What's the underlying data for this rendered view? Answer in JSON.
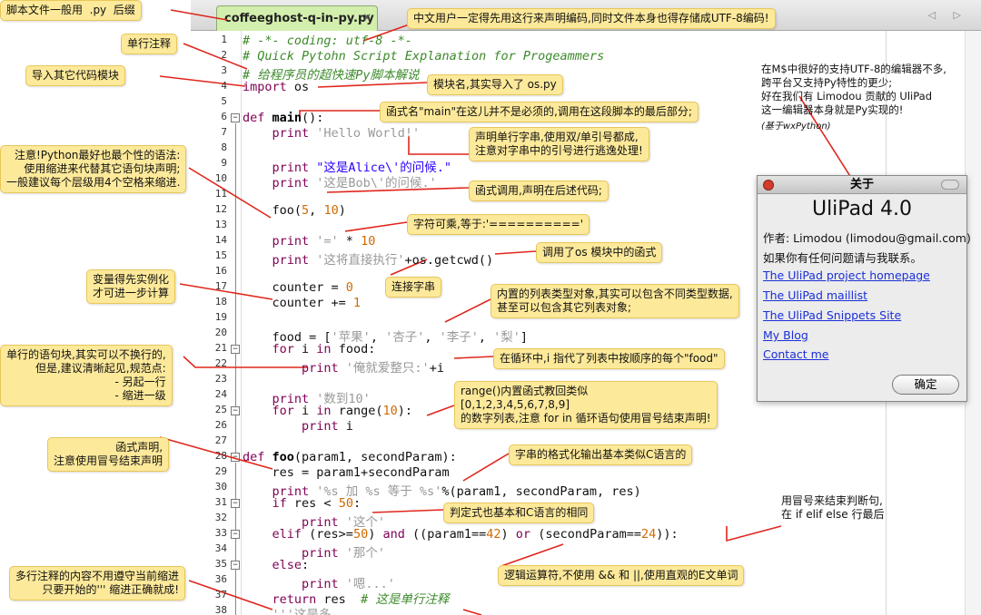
{
  "tab": {
    "filename": "coffeeghost-q-in-py.py",
    "close": "×",
    "nav": "◁ ▷"
  },
  "code_lines": [
    {
      "n": "1",
      "segs": [
        {
          "t": "# -*- coding: utf-8 -*-",
          "c": "cm"
        }
      ]
    },
    {
      "n": "2",
      "segs": [
        {
          "t": "# Quick Pytohn Script Explanation for Progeammers",
          "c": "cm"
        }
      ]
    },
    {
      "n": "3",
      "segs": [
        {
          "t": "# 给程序员的超快速Py脚本解说",
          "c": "cm"
        }
      ]
    },
    {
      "n": "4",
      "segs": [
        {
          "t": "import",
          "c": "kw"
        },
        {
          "t": " os",
          "c": ""
        }
      ]
    },
    {
      "n": "5",
      "segs": []
    },
    {
      "n": "6",
      "segs": [
        {
          "t": "def",
          "c": "kw"
        },
        {
          "t": " ",
          "c": ""
        },
        {
          "t": "main",
          "c": "fn"
        },
        {
          "t": "():",
          "c": ""
        }
      ]
    },
    {
      "n": "7",
      "segs": [
        {
          "t": "    print",
          "c": "kw"
        },
        {
          "t": " 'Hello World!'",
          "c": "str"
        }
      ]
    },
    {
      "n": "8",
      "segs": []
    },
    {
      "n": "9",
      "segs": [
        {
          "t": "    print",
          "c": "kw"
        },
        {
          "t": " \"这是Alice\\'的问候.\"",
          "c": "dq"
        }
      ]
    },
    {
      "n": "10",
      "segs": [
        {
          "t": "    print",
          "c": "kw"
        },
        {
          "t": " '这是Bob\\'的问候.'",
          "c": "str"
        }
      ]
    },
    {
      "n": "11",
      "segs": []
    },
    {
      "n": "12",
      "segs": [
        {
          "t": "    foo(",
          "c": ""
        },
        {
          "t": "5",
          "c": "num"
        },
        {
          "t": ", ",
          "c": ""
        },
        {
          "t": "10",
          "c": "num"
        },
        {
          "t": ")",
          "c": ""
        }
      ]
    },
    {
      "n": "13",
      "segs": []
    },
    {
      "n": "14",
      "segs": [
        {
          "t": "    print",
          "c": "kw"
        },
        {
          "t": " '='",
          "c": "str"
        },
        {
          "t": " * ",
          "c": ""
        },
        {
          "t": "10",
          "c": "num"
        }
      ]
    },
    {
      "n": "15",
      "segs": [
        {
          "t": "    print",
          "c": "kw"
        },
        {
          "t": " '这将直接执行'",
          "c": "str"
        },
        {
          "t": "+os.getcwd()",
          "c": ""
        }
      ]
    },
    {
      "n": "16",
      "segs": []
    },
    {
      "n": "17",
      "segs": [
        {
          "t": "    counter = ",
          "c": ""
        },
        {
          "t": "0",
          "c": "num"
        }
      ]
    },
    {
      "n": "18",
      "segs": [
        {
          "t": "    counter += ",
          "c": ""
        },
        {
          "t": "1",
          "c": "num"
        }
      ]
    },
    {
      "n": "19",
      "segs": []
    },
    {
      "n": "20",
      "segs": [
        {
          "t": "    food = [",
          "c": ""
        },
        {
          "t": "'苹果'",
          "c": "str"
        },
        {
          "t": ", ",
          "c": ""
        },
        {
          "t": "'杏子'",
          "c": "str"
        },
        {
          "t": ", ",
          "c": ""
        },
        {
          "t": "'李子'",
          "c": "str"
        },
        {
          "t": ", ",
          "c": ""
        },
        {
          "t": "'梨'",
          "c": "str"
        },
        {
          "t": "]",
          "c": ""
        }
      ]
    },
    {
      "n": "21",
      "segs": [
        {
          "t": "    for",
          "c": "kw"
        },
        {
          "t": " i ",
          "c": ""
        },
        {
          "t": "in",
          "c": "kw"
        },
        {
          "t": " food:",
          "c": ""
        }
      ]
    },
    {
      "n": "22",
      "segs": [
        {
          "t": "        print",
          "c": "kw"
        },
        {
          "t": " '俺就爱整只:'",
          "c": "str"
        },
        {
          "t": "+i",
          "c": ""
        }
      ]
    },
    {
      "n": "23",
      "segs": []
    },
    {
      "n": "24",
      "segs": [
        {
          "t": "    print",
          "c": "kw"
        },
        {
          "t": " '数到10'",
          "c": "str"
        }
      ]
    },
    {
      "n": "25",
      "segs": [
        {
          "t": "    for",
          "c": "kw"
        },
        {
          "t": " i ",
          "c": ""
        },
        {
          "t": "in",
          "c": "kw"
        },
        {
          "t": " range(",
          "c": ""
        },
        {
          "t": "10",
          "c": "num"
        },
        {
          "t": "):",
          "c": ""
        }
      ]
    },
    {
      "n": "26",
      "segs": [
        {
          "t": "        print",
          "c": "kw"
        },
        {
          "t": " i",
          "c": ""
        }
      ]
    },
    {
      "n": "27",
      "segs": []
    },
    {
      "n": "28",
      "segs": [
        {
          "t": "def",
          "c": "kw"
        },
        {
          "t": " ",
          "c": ""
        },
        {
          "t": "foo",
          "c": "fn"
        },
        {
          "t": "(param1, secondParam):",
          "c": ""
        }
      ]
    },
    {
      "n": "29",
      "segs": [
        {
          "t": "    res = param1+secondParam",
          "c": ""
        }
      ]
    },
    {
      "n": "30",
      "segs": [
        {
          "t": "    print",
          "c": "kw"
        },
        {
          "t": " '%s 加 %s 等于 %s'",
          "c": "str"
        },
        {
          "t": "%(param1, secondParam, res)",
          "c": ""
        }
      ]
    },
    {
      "n": "31",
      "segs": [
        {
          "t": "    if",
          "c": "kw"
        },
        {
          "t": " res < ",
          "c": ""
        },
        {
          "t": "50",
          "c": "num"
        },
        {
          "t": ":",
          "c": ""
        }
      ]
    },
    {
      "n": "32",
      "segs": [
        {
          "t": "        print",
          "c": "kw"
        },
        {
          "t": " '这个'",
          "c": "str"
        }
      ]
    },
    {
      "n": "33",
      "segs": [
        {
          "t": "    elif",
          "c": "kw"
        },
        {
          "t": " (res>=",
          "c": ""
        },
        {
          "t": "50",
          "c": "num"
        },
        {
          "t": ") ",
          "c": ""
        },
        {
          "t": "and",
          "c": "kw"
        },
        {
          "t": " ((param1==",
          "c": ""
        },
        {
          "t": "42",
          "c": "num"
        },
        {
          "t": ") ",
          "c": ""
        },
        {
          "t": "or",
          "c": "kw"
        },
        {
          "t": " (secondParam==",
          "c": ""
        },
        {
          "t": "24",
          "c": "num"
        },
        {
          "t": ")):",
          "c": ""
        }
      ]
    },
    {
      "n": "34",
      "segs": [
        {
          "t": "        print",
          "c": "kw"
        },
        {
          "t": " '那个'",
          "c": "str"
        }
      ]
    },
    {
      "n": "35",
      "segs": [
        {
          "t": "    else",
          "c": "kw"
        },
        {
          "t": ":",
          "c": ""
        }
      ]
    },
    {
      "n": "36",
      "segs": [
        {
          "t": "        print",
          "c": "kw"
        },
        {
          "t": " '嗯...'",
          "c": "str"
        }
      ]
    },
    {
      "n": "37",
      "segs": [
        {
          "t": "    return",
          "c": "kw"
        },
        {
          "t": " res  ",
          "c": ""
        },
        {
          "t": "# 这是单行注释",
          "c": "cm"
        }
      ]
    },
    {
      "n": "38",
      "segs": [
        {
          "t": "    '''这是多",
          "c": "str"
        }
      ]
    }
  ],
  "notes": {
    "suffix": "脚本文件一般用  .py  后缀",
    "single_comment": "单行注释",
    "import_module": "导入其它代码模块",
    "encoding": "中文用户一定得先用这行来声明编码,同时文件本身也得存储成UTF-8编码!",
    "module_name": "模块名,其实导入了 os.py",
    "main_func": "函式名\"main\"在这儿并不是必须的,调用在这段脚本的最后部分;",
    "indent": "注意!Python最好也最个性的语法:\n使用缩进来代替其它语句块声明;\n一般建议每个层级用4个空格来缩进.",
    "quote": "声明单行字串,使用双/单引号都成,\n注意对字串中的引号进行逃逸处理!",
    "call_func": "函式调用,声明在后述代码;",
    "str_mul": "字符可乘,等于:'=========='",
    "os_call": "调用了os 模块中的函式",
    "concat": "连接字串",
    "var_init": "变量得先实例化\n才可进一步计算",
    "list_type": "内置的列表类型对象,其实可以包含不同类型数据,\n甚至可以包含其它列表对象;",
    "single_block": "单行的语句块,其实可以不换行的,\n但是,建议清晰起见,规范点:\n- 另起一行\n- 缩进一级",
    "for_loop": "在循环中,i 指代了列表中按顺序的每个\"food\"",
    "range_func": "range()内置函式教回类似\n[0,1,2,3,4,5,6,7,8,9]\n的数字列表,注意 for in 循环语句使用冒号结束声明!",
    "func_decl": "函式声明,\n注意使用冒号结束声明",
    "format": "字串的格式化输出基本类似C语言的",
    "cond": "判定式也基本和C语言的相同",
    "colon_end": "用冒号来结束判断句,\n在 if elif else 行最后",
    "logic": "逻辑运算符,不使用 && 和 ||,使用直观的E文单词",
    "multiline": "多行注释的内容不用遵守当前缩进\n只要开始的''' 缩进正确就成!",
    "ulipad": "在M$中很好的支持UTF-8的编辑器不多,\n跨平台又支持Py特性的更少;\n好在我们有 Limodou 贡献的 UliPad\n这一编辑器本身就是Py实现的!",
    "wxpython": "(基于wxPython)"
  },
  "about": {
    "title": "关于",
    "app_name": "UliPad 4.0",
    "author": "作者: Limodou (limodou@gmail.com)",
    "contact_hint": "如果你有任何问题请与我联系。",
    "links": [
      "The UliPad project homepage",
      "The UliPad maillist",
      "The UliPad Snippets Site",
      "My Blog",
      "Contact me"
    ],
    "ok": "确定"
  },
  "colors": {
    "accent_line": "#e0261c",
    "bubble": "#fde99a",
    "gutter_green": "#d3efad"
  }
}
